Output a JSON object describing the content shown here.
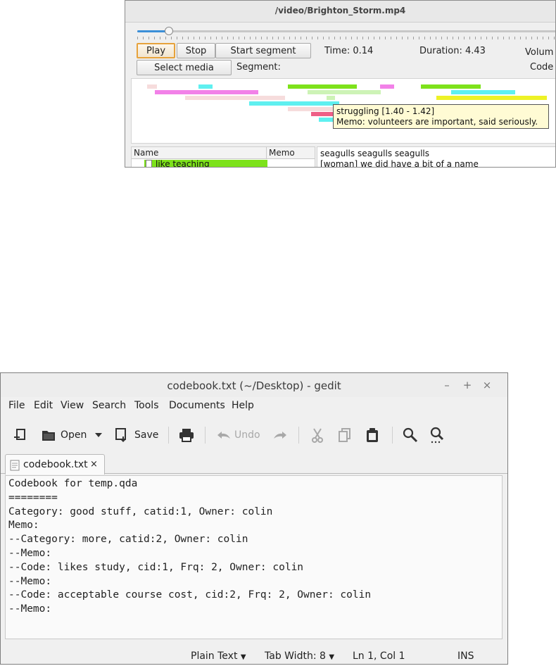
{
  "player": {
    "file_path": "/video/Brighton_Storm.mp4",
    "progress_fraction": 0.032,
    "buttons": {
      "play": "Play",
      "stop": "Stop",
      "start_segment": "Start segment",
      "select_media": "Select media"
    },
    "time": "Time: 0.14",
    "duration": "Duration: 4.43",
    "volume_label": "Volum",
    "segment_label": "Segment:",
    "code_label": "Code",
    "tooltip": {
      "line1": "struggling [1.40 - 1.42]",
      "line2": "Memo: volunteers are important, said seriously."
    },
    "tree": {
      "col_name": "Name",
      "col_memo": "Memo",
      "first_item": "like teaching"
    },
    "transcript": {
      "line1": "seagulls seagulls seagulls",
      "line2": "[woman] we did have a bit of a name"
    },
    "colors": {
      "green": "#7ee21b",
      "pink": "#f281e8",
      "cyan": "#5ff0f0",
      "yellow": "#eef226",
      "rose": "#ee5f86",
      "pale_pink": "#f6dcdc",
      "pale_green": "#cdf3b6"
    }
  },
  "gedit": {
    "title": "codebook.txt (~/Desktop) - gedit",
    "window_controls": [
      "–",
      "+",
      "×"
    ],
    "menu": [
      "File",
      "Edit",
      "View",
      "Search",
      "Tools",
      "Documents",
      "Help"
    ],
    "toolbar": {
      "open": "Open",
      "save": "Save",
      "undo": "Undo"
    },
    "tab_label": "codebook.txt",
    "tab_close": "×",
    "lines": [
      "Codebook for temp.qda",
      "========",
      "Category: good stuff, catid:1, Owner: colin",
      "Memo:",
      "--Category: more, catid:2, Owner: colin",
      "--Memo:",
      "--Code: likes study, cid:1, Frq: 2, Owner: colin",
      "--Memo:",
      "--Code: acceptable course cost, cid:2, Frq: 2, Owner: colin",
      "--Memo:"
    ],
    "status": {
      "syntax": "Plain Text",
      "tab_width": "Tab Width: 8",
      "position": "Ln 1, Col 1",
      "mode": "INS"
    }
  }
}
